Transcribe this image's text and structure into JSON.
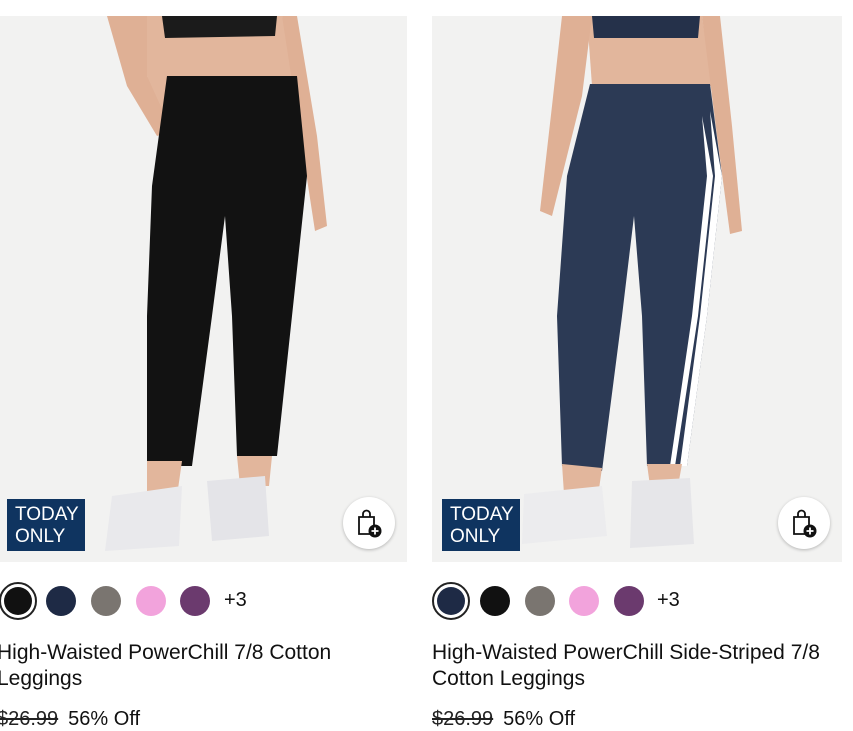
{
  "products": [
    {
      "badge": [
        "TODAY",
        "ONLY"
      ],
      "legging_color": "#121212",
      "swatches": [
        {
          "name": "black",
          "color": "#111111",
          "selected": true
        },
        {
          "name": "navy",
          "color": "#1e2a45",
          "selected": false
        },
        {
          "name": "gray",
          "color": "#7a7570",
          "selected": false
        },
        {
          "name": "pink",
          "color": "#f2a3dc",
          "selected": false
        },
        {
          "name": "purple",
          "color": "#6b3a6e",
          "selected": false
        }
      ],
      "more_colors": "+3",
      "title": "High-Waisted PowerChill 7/8 Cotton Leggings",
      "old_price": "$26.99",
      "discount": "56% Off"
    },
    {
      "badge": [
        "TODAY",
        "ONLY"
      ],
      "legging_color": "#2c3a55",
      "swatches": [
        {
          "name": "navy",
          "color": "#1e2a45",
          "selected": true
        },
        {
          "name": "black",
          "color": "#111111",
          "selected": false
        },
        {
          "name": "gray",
          "color": "#7a7570",
          "selected": false
        },
        {
          "name": "pink",
          "color": "#f2a3dc",
          "selected": false
        },
        {
          "name": "purple",
          "color": "#6b3a6e",
          "selected": false
        }
      ],
      "more_colors": "+3",
      "title": "High-Waisted PowerChill Side-Striped 7/8 Cotton Leggings",
      "old_price": "$26.99",
      "discount": "56% Off"
    }
  ],
  "badge_color": "#0f3460"
}
